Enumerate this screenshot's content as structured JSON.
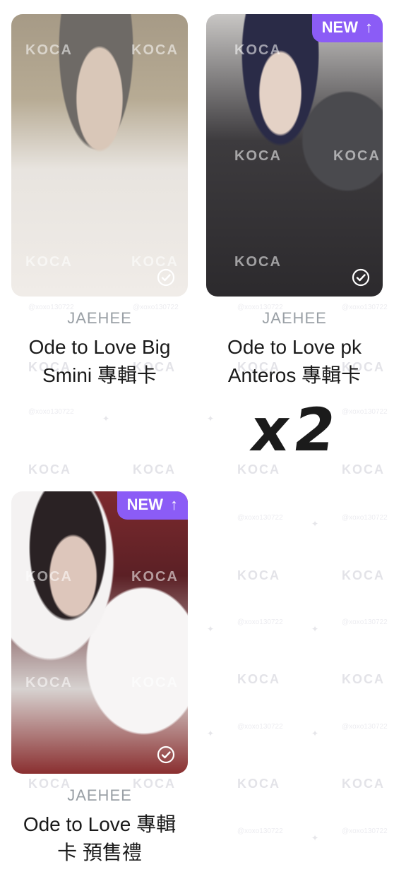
{
  "watermark": {
    "logo_text": "KOCA",
    "handle": "@xoxo130722"
  },
  "cards": [
    {
      "artist": "JAEHEE",
      "title": "Ode to Love Big Smini 專輯卡",
      "is_new": false,
      "checked": true
    },
    {
      "artist": "JAEHEE",
      "title": "Ode to Love pk Anteros 專輯卡",
      "is_new": true,
      "badge_label": "NEW",
      "checked": true,
      "quantity_mark": "x2"
    },
    {
      "artist": "JAEHEE",
      "title": "Ode to Love 專輯卡 預售禮",
      "is_new": true,
      "badge_label": "NEW",
      "checked": true
    }
  ],
  "colors": {
    "badge": "#8b5cf6",
    "artist_text": "#9aa0a6",
    "title_text": "#1a1a1a"
  },
  "icons": {
    "badge_arrow": "arrow-up-icon",
    "check": "check-circle-icon"
  }
}
